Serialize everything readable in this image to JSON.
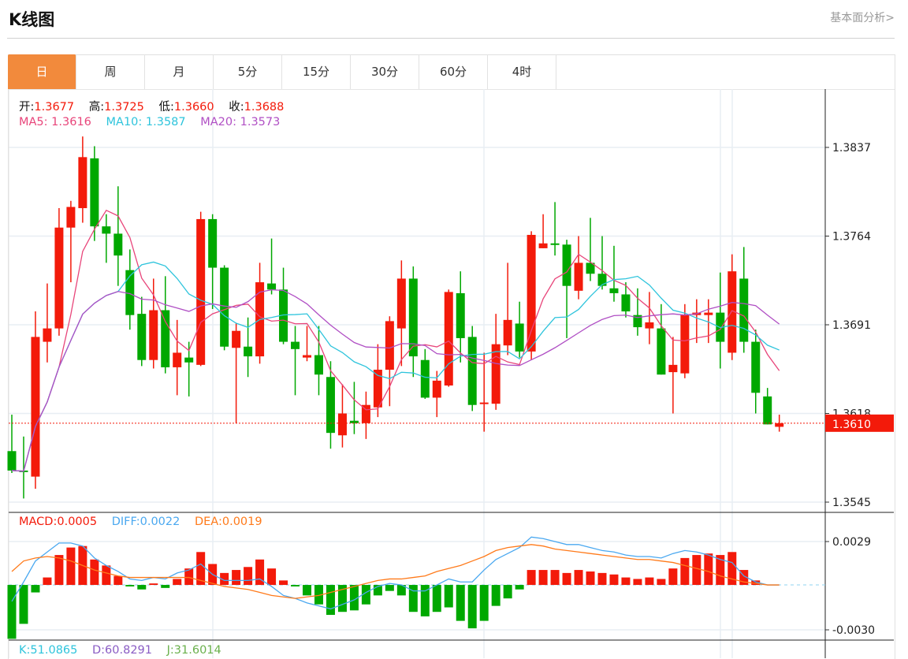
{
  "header": {
    "title": "K线图",
    "link": "基本面分析>"
  },
  "tabs": [
    {
      "label": "日",
      "active": true
    },
    {
      "label": "周"
    },
    {
      "label": "月"
    },
    {
      "label": "5分"
    },
    {
      "label": "15分"
    },
    {
      "label": "30分"
    },
    {
      "label": "60分"
    },
    {
      "label": "4时"
    }
  ],
  "ohlc_info": {
    "open_label": "开:",
    "open": "1.3677",
    "high_label": "高:",
    "high": "1.3725",
    "low_label": "低:",
    "low": "1.3660",
    "close_label": "收:",
    "close": "1.3688"
  },
  "ma_info": {
    "ma5_label": "MA5:",
    "ma5": "1.3616",
    "ma10_label": "MA10:",
    "ma10": "1.3587",
    "ma20_label": "MA20:",
    "ma20": "1.3573"
  },
  "macd_info": {
    "macd_label": "MACD:",
    "macd": "0.0005",
    "diff_label": "DIFF:",
    "diff": "0.0022",
    "dea_label": "DEA:",
    "dea": "0.0019"
  },
  "kdj_info": {
    "k_label": "K:",
    "k": "51.0865",
    "d_label": "D:",
    "d": "60.8291",
    "j_label": "J:",
    "j": "31.6014"
  },
  "colors": {
    "up": "#f31a0a",
    "down": "#00a800",
    "ma5": "#e8457a",
    "ma10": "#2ec4dc",
    "ma20": "#b04fc4",
    "diff": "#4aa8f0",
    "dea": "#ff7a1a",
    "active_tab": "#f28a3c",
    "last_price": "#f31a0a",
    "k": "#2ec4dc",
    "d": "#8a5cc4",
    "j": "#6ab04c"
  },
  "chart_data": [
    {
      "type": "candlestick",
      "price_ticks": [
        "1.3837",
        "1.3764",
        "1.3691",
        "1.3618",
        "1.3545"
      ],
      "ylim": [
        1.3545,
        1.3837
      ],
      "last_price": "1.3610",
      "grid": true,
      "candles": [
        [
          1.3587,
          1.3617,
          1.3569,
          1.3571
        ],
        [
          1.3571,
          1.3599,
          1.3548,
          1.357
        ],
        [
          1.3566,
          1.3702,
          1.3556,
          1.3681
        ],
        [
          1.3677,
          1.3725,
          1.366,
          1.3688
        ],
        [
          1.3688,
          1.3787,
          1.3682,
          1.3771
        ],
        [
          1.3771,
          1.3793,
          1.3726,
          1.3788
        ],
        [
          1.3787,
          1.3846,
          1.3775,
          1.3829
        ],
        [
          1.3828,
          1.3838,
          1.376,
          1.3772
        ],
        [
          1.3772,
          1.3782,
          1.3742,
          1.3766
        ],
        [
          1.3766,
          1.3805,
          1.3723,
          1.3748
        ],
        [
          1.3736,
          1.3753,
          1.3687,
          1.3699
        ],
        [
          1.37,
          1.3714,
          1.3657,
          1.3662
        ],
        [
          1.3662,
          1.3729,
          1.3655,
          1.3703
        ],
        [
          1.3703,
          1.3731,
          1.3651,
          1.3656
        ],
        [
          1.3656,
          1.3695,
          1.3633,
          1.3668
        ],
        [
          1.3664,
          1.3677,
          1.3632,
          1.366
        ],
        [
          1.3658,
          1.3784,
          1.3657,
          1.3778
        ],
        [
          1.3778,
          1.3782,
          1.3704,
          1.3738
        ],
        [
          1.3738,
          1.374,
          1.367,
          1.3673
        ],
        [
          1.3672,
          1.3692,
          1.361,
          1.3686
        ],
        [
          1.3673,
          1.3697,
          1.3648,
          1.3665
        ],
        [
          1.3665,
          1.3742,
          1.3659,
          1.3726
        ],
        [
          1.3725,
          1.3762,
          1.3716,
          1.372
        ],
        [
          1.372,
          1.3738,
          1.3675,
          1.3677
        ],
        [
          1.3677,
          1.369,
          1.3633,
          1.3671
        ],
        [
          1.3664,
          1.369,
          1.3661,
          1.3666
        ],
        [
          1.3666,
          1.369,
          1.3633,
          1.365
        ],
        [
          1.3648,
          1.3661,
          1.3589,
          1.3602
        ],
        [
          1.36,
          1.3642,
          1.359,
          1.3618
        ],
        [
          1.3612,
          1.3644,
          1.3601,
          1.361
        ],
        [
          1.361,
          1.3636,
          1.3597,
          1.3625
        ],
        [
          1.3623,
          1.3675,
          1.3615,
          1.3654
        ],
        [
          1.3654,
          1.3698,
          1.3624,
          1.3694
        ],
        [
          1.3688,
          1.3744,
          1.3657,
          1.3729
        ],
        [
          1.3729,
          1.3739,
          1.3648,
          1.3665
        ],
        [
          1.3662,
          1.3671,
          1.363,
          1.3631
        ],
        [
          1.3631,
          1.3653,
          1.3615,
          1.3645
        ],
        [
          1.3641,
          1.372,
          1.364,
          1.3718
        ],
        [
          1.3717,
          1.3735,
          1.366,
          1.368
        ],
        [
          1.3681,
          1.369,
          1.362,
          1.3625
        ],
        [
          1.3626,
          1.3668,
          1.3603,
          1.3627
        ],
        [
          1.3626,
          1.37,
          1.3621,
          1.3675
        ],
        [
          1.3674,
          1.3742,
          1.3666,
          1.3695
        ],
        [
          1.3692,
          1.371,
          1.3664,
          1.3669
        ],
        [
          1.3669,
          1.3768,
          1.3662,
          1.3765
        ],
        [
          1.3754,
          1.3782,
          1.3754,
          1.3758
        ],
        [
          1.3758,
          1.3792,
          1.3748,
          1.3757
        ],
        [
          1.3757,
          1.3761,
          1.368,
          1.3723
        ],
        [
          1.3719,
          1.3764,
          1.3712,
          1.3742
        ],
        [
          1.3742,
          1.3779,
          1.3727,
          1.3733
        ],
        [
          1.3733,
          1.3764,
          1.372,
          1.3723
        ],
        [
          1.3721,
          1.3756,
          1.371,
          1.3717
        ],
        [
          1.3716,
          1.3726,
          1.3697,
          1.3702
        ],
        [
          1.3699,
          1.3721,
          1.3682,
          1.3689
        ],
        [
          1.3688,
          1.3718,
          1.3675,
          1.3693
        ],
        [
          1.3688,
          1.3708,
          1.365,
          1.365
        ],
        [
          1.3652,
          1.3681,
          1.3618,
          1.3658
        ],
        [
          1.3651,
          1.3708,
          1.3647,
          1.3699
        ],
        [
          1.3699,
          1.3712,
          1.3676,
          1.3701
        ],
        [
          1.3699,
          1.3712,
          1.3676,
          1.3701
        ],
        [
          1.3701,
          1.3734,
          1.3655,
          1.3677
        ],
        [
          1.3668,
          1.3749,
          1.3662,
          1.3735
        ],
        [
          1.3729,
          1.3755,
          1.3668,
          1.3677
        ],
        [
          1.3677,
          1.3687,
          1.3618,
          1.3635
        ],
        [
          1.3632,
          1.3639,
          1.3609,
          1.3609
        ],
        [
          1.3607,
          1.3617,
          1.3603,
          1.361
        ]
      ],
      "ma_periods": [
        5,
        10,
        20
      ]
    },
    {
      "type": "macd",
      "ticks": [
        "0.0029",
        "-0.0030"
      ],
      "ylim": [
        -0.003,
        0.0029
      ],
      "macd": [
        -0.0036,
        -0.0026,
        -0.0005,
        0.0005,
        0.002,
        0.0025,
        0.0026,
        0.0017,
        0.0013,
        0.0006,
        -0.0001,
        -0.0003,
        0.0001,
        -0.0002,
        0.0004,
        0.0011,
        0.0022,
        0.0014,
        0.0008,
        0.001,
        0.0012,
        0.0017,
        0.0011,
        0.0003,
        -0.0001,
        -0.0007,
        -0.0013,
        -0.002,
        -0.0018,
        -0.0017,
        -0.0013,
        -0.0007,
        -0.0004,
        -0.0007,
        -0.0018,
        -0.0021,
        -0.0018,
        -0.0015,
        -0.0024,
        -0.0029,
        -0.0024,
        -0.0014,
        -0.0009,
        -0.0003,
        0.001,
        0.001,
        0.001,
        0.0008,
        0.001,
        0.0009,
        0.0008,
        0.0007,
        0.0005,
        0.0004,
        0.0005,
        0.0004,
        0.0011,
        0.0018,
        0.002,
        0.0021,
        0.002,
        0.0022,
        0.001,
        0.0003,
        0.0,
        0.0
      ],
      "diff": [
        -0.0011,
        0.0002,
        0.0016,
        0.0022,
        0.0028,
        0.0028,
        0.0026,
        0.0018,
        0.0013,
        0.0009,
        0.0004,
        0.0003,
        0.0005,
        0.0004,
        0.0008,
        0.001,
        0.0014,
        0.0007,
        0.0003,
        0.0003,
        0.0003,
        0.0004,
        -0.0001,
        -0.0007,
        -0.0009,
        -0.0012,
        -0.0014,
        -0.0016,
        -0.0013,
        -0.001,
        -0.0005,
        -0.0001,
        0.0001,
        0.0,
        -0.0004,
        -0.0004,
        0.0,
        0.0004,
        0.0002,
        0.0002,
        0.001,
        0.0017,
        0.0021,
        0.0025,
        0.0032,
        0.0031,
        0.0029,
        0.0027,
        0.0027,
        0.0025,
        0.0023,
        0.0022,
        0.002,
        0.0019,
        0.0019,
        0.0018,
        0.0021,
        0.0023,
        0.0022,
        0.002,
        0.0017,
        0.0015,
        0.0006,
        0.0002,
        0.0,
        0.0
      ],
      "dea": [
        0.0009,
        0.0016,
        0.0018,
        0.0019,
        0.0018,
        0.0016,
        0.0013,
        0.001,
        0.0008,
        0.0006,
        0.0005,
        0.0005,
        0.0005,
        0.0005,
        0.0005,
        0.0005,
        0.0003,
        0.0001,
        -0.0001,
        -0.0002,
        -0.0003,
        -0.0005,
        -0.0007,
        -0.0008,
        -0.0009,
        -0.0008,
        -0.0007,
        -0.0005,
        -0.0003,
        -0.0001,
        0.0001,
        0.0003,
        0.0004,
        0.0004,
        0.0005,
        0.0006,
        0.0009,
        0.0011,
        0.0013,
        0.0016,
        0.0019,
        0.0023,
        0.0025,
        0.0026,
        0.0027,
        0.0026,
        0.0024,
        0.0023,
        0.0022,
        0.0021,
        0.002,
        0.0019,
        0.0018,
        0.0017,
        0.0017,
        0.0016,
        0.0015,
        0.0013,
        0.0011,
        0.0009,
        0.0006,
        0.0004,
        0.0002,
        0.0001,
        0.0,
        0.0
      ]
    }
  ]
}
